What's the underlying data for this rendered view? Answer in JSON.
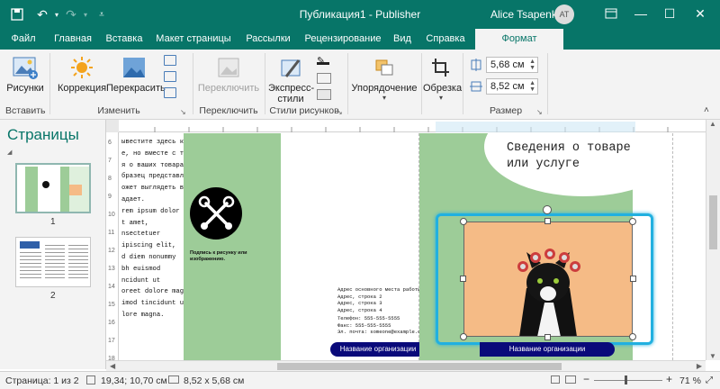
{
  "titlebar": {
    "title": "Публикация1 - Publisher",
    "user": "Alice Tsapenko",
    "avatar_initials": "AT"
  },
  "tabs": [
    {
      "label": "Файл"
    },
    {
      "label": "Главная"
    },
    {
      "label": "Вставка"
    },
    {
      "label": "Макет страницы"
    },
    {
      "label": "Рассылки"
    },
    {
      "label": "Рецензирование"
    },
    {
      "label": "Вид"
    },
    {
      "label": "Справка"
    },
    {
      "label": "Формат"
    }
  ],
  "ribbon": {
    "insert": {
      "pictures": "Рисунки",
      "group": "Вставить"
    },
    "change": {
      "correction": "Коррекция",
      "recolor": "Перекрасить",
      "group": "Изменить"
    },
    "switch": {
      "label": "Переключить",
      "group": "Переключить"
    },
    "styles": {
      "express_line1": "Экспресс-",
      "express_line2": "стили",
      "group": "Стили рисунков"
    },
    "arrange": {
      "label": "Упорядочение"
    },
    "crop": {
      "label": "Обрезка"
    },
    "size": {
      "height": "5,68 см",
      "width": "8,52 см",
      "group": "Размер"
    }
  },
  "pages_panel": {
    "title": "Страницы",
    "pages": [
      {
        "num": "1"
      },
      {
        "num": "2"
      }
    ]
  },
  "document": {
    "body_lines": [
      "ывестите здесь краткие обобщен-",
      "е, но вместе с тем важные, све-",
      "я о ваших товарах или услугах.",
      "бразец представленного товара",
      "ожет выглядеть вместе сюда не по-",
      "адает.",
      "",
      "rem ipsum dolor",
      "t amet,",
      "nsectetuer",
      "ipiscing elit,",
      "d diem nonummy",
      "bh euismod",
      "ncidunt ut",
      "oreet dolore magna aligih",
      "imod tincidunt ut lacreet",
      "lore magna."
    ],
    "caption": "Подпись к рисунку или изображению.",
    "heading": "Сведения о товаре или услуге",
    "address_lines": [
      "Адрес основного места работы",
      "Адрес, строка 2",
      "Адрес, строка 3",
      "Адрес, строка 4"
    ],
    "contact_lines": [
      "Телефон: 555-555-5555",
      "Факс: 555-555-5555",
      "Эл. почта: someone@example.com"
    ],
    "org_name_left": "Название организации",
    "org_name_right": "Название организации",
    "left_ruler_numbers": [
      "6",
      "7",
      "8",
      "9",
      "10",
      "11",
      "12",
      "13",
      "14",
      "15",
      "16",
      "17",
      "18"
    ]
  },
  "statusbar": {
    "page": "Страница: 1 из 2",
    "position": "19,34; 10,70 см",
    "size": "8,52 x 5,68 см",
    "zoom": "71 %"
  },
  "colors": {
    "accent": "#077568",
    "green": "#9dcc98",
    "navy": "#0a0a7a",
    "photo_bg": "#f5bb86",
    "frame": "#21b0e0"
  }
}
